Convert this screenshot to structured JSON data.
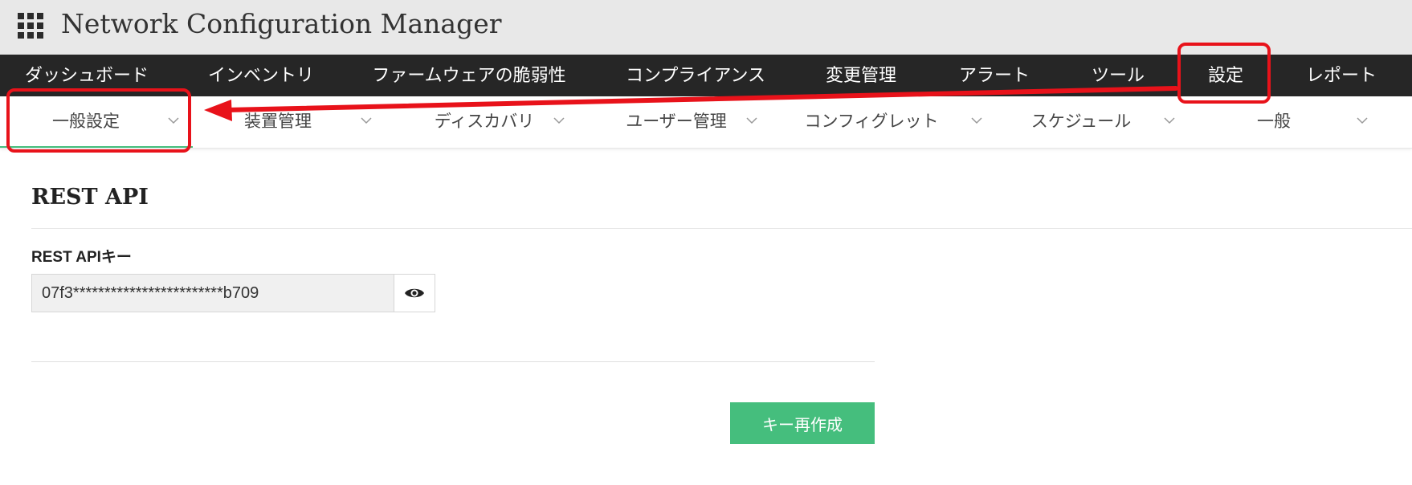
{
  "app": {
    "title": "Network Configuration Manager",
    "menu_icon": "grid-menu-icon"
  },
  "main_nav": {
    "items": [
      {
        "label": "ダッシュボード"
      },
      {
        "label": "インベントリ"
      },
      {
        "label": "ファームウェアの脆弱性"
      },
      {
        "label": "コンプライアンス"
      },
      {
        "label": "変更管理"
      },
      {
        "label": "アラート"
      },
      {
        "label": "ツール"
      },
      {
        "label": "設定",
        "selected": true
      },
      {
        "label": "レポート"
      }
    ]
  },
  "sub_nav": {
    "items": [
      {
        "label": "一般設定",
        "selected": true
      },
      {
        "label": "装置管理"
      },
      {
        "label": "ディスカバリ"
      },
      {
        "label": "ユーザー管理"
      },
      {
        "label": "コンフィグレット"
      },
      {
        "label": "スケジュール"
      },
      {
        "label": "一般"
      }
    ],
    "dropdown_icon": "chevron-down-icon"
  },
  "page": {
    "section_title": "REST API",
    "key_label": "REST APIキー",
    "key_value": "07f3************************b709",
    "reveal_icon": "eye-icon",
    "regenerate_button": "キー再作成"
  },
  "colors": {
    "title_bar": "#e8e8e8",
    "nav_bar": "#262626",
    "accent_green": "#45be7d",
    "annotation_red": "#e8121a"
  },
  "annotations": {
    "highlight_boxes": [
      "main-nav-settings",
      "subnav-general-settings"
    ],
    "arrow": "from main-nav-settings to subnav-general-settings"
  }
}
